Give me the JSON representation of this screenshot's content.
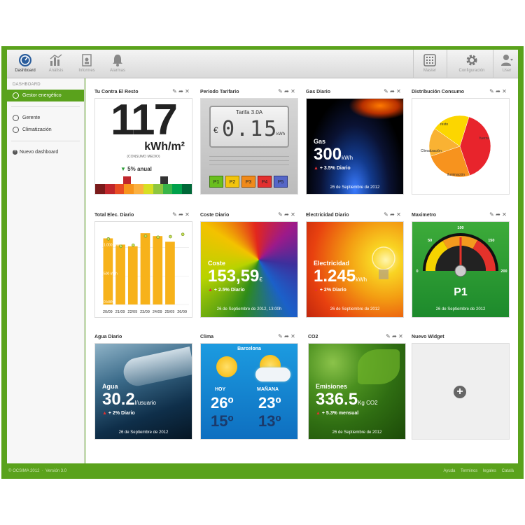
{
  "toolbar": {
    "left": [
      {
        "label": "Dashboard",
        "icon": "dashboard-icon"
      },
      {
        "label": "Análisis",
        "icon": "analysis-icon"
      },
      {
        "label": "Informes",
        "icon": "reports-icon"
      },
      {
        "label": "Alarmas",
        "icon": "bell-icon"
      }
    ],
    "right": [
      {
        "label": "Master",
        "icon": "grid-icon"
      },
      {
        "label": "Configuración",
        "icon": "gear-icon"
      },
      {
        "label": "User",
        "icon": "user-icon"
      }
    ]
  },
  "sidebar": {
    "section": "DASHBOARD",
    "items": [
      {
        "label": "Gestor energético",
        "active": true
      },
      {
        "label": "Gerente"
      },
      {
        "label": "Climatización"
      }
    ],
    "new_dashboard": "Nuevo dashboard"
  },
  "widgets": {
    "contra": {
      "title": "Tu Contra El Resto",
      "value": "117",
      "unit": "kWh/m²",
      "caption": "(CONSUMO MEDIO)",
      "trend": "5% anual"
    },
    "periodo": {
      "title": "Periodo Tarifario",
      "tarifa": "Tarifa 3.0A",
      "reading": "0.15",
      "currency": "€",
      "unit": "kWh",
      "periods": [
        "P1",
        "P2",
        "P3",
        "P4",
        "P5"
      ]
    },
    "gas": {
      "title": "Gas Diario",
      "label": "Gas",
      "value": "300",
      "unit": "kWh",
      "trend": "+ 3.5% Diario",
      "date": "26 de Septiembre de 2012"
    },
    "distribucion": {
      "title": "Distribución Consumo",
      "labels": [
        "resto",
        "fuerza",
        "Climatización",
        "iluminación"
      ]
    },
    "total": {
      "title": "Total Elec. Diario"
    },
    "coste": {
      "title": "Coste Diario",
      "label": "Coste",
      "value": "153,59",
      "unit": "€",
      "trend": "+ 2.5% Diario",
      "date": "26 de Septiembre de 2012, 13:00h"
    },
    "electricidad": {
      "title": "Electricidad Diario",
      "label": "Electricidad",
      "value": "1.245",
      "unit": "kWh",
      "trend": "+ 2% Diario",
      "date": "26 de Septiembre de 2012"
    },
    "maximetro": {
      "title": "Maximetro",
      "period": "P1",
      "date": "26 de Septiembre de 2012",
      "ticks": [
        "0",
        "50",
        "100",
        "150",
        "200"
      ]
    },
    "agua": {
      "title": "Agua Diario",
      "label": "Agua",
      "value": "30.2",
      "unit": "l/usuario",
      "trend": "+ 2% Diario",
      "date": "26 de Septiembre de 2012"
    },
    "clima": {
      "title": "Clima",
      "city": "Barcelona",
      "today": "HOY",
      "tomorrow": "MAÑANA",
      "today_max": "26º",
      "today_min": "15º",
      "tomorrow_max": "23º",
      "tomorrow_min": "13º"
    },
    "co2": {
      "title": "CO2",
      "label": "Emisiones",
      "value": "336.5",
      "unit": "Kg CO2",
      "trend": "+ 5.3% mensual",
      "date": "26 de Septiembre de 2012"
    },
    "nuevo": {
      "title": "Nuevo Widget"
    }
  },
  "chart_data": [
    {
      "type": "bar",
      "categories": [
        "20/09",
        "21/09",
        "22/09",
        "23/09",
        "24/09",
        "25/09",
        "26/09"
      ],
      "values": [
        1160,
        1050,
        1020,
        1250,
        1200,
        1100,
        null
      ],
      "markers": [
        1150,
        1020,
        1040,
        1200,
        1180,
        1190,
        1230
      ],
      "yticks": [
        "0 kWh",
        "500 kWh",
        "1.000 kWh"
      ],
      "ylim": [
        0,
        1350
      ]
    },
    {
      "type": "pie",
      "labels": [
        "fuerza",
        "iluminación",
        "Climatización",
        "resto"
      ],
      "values": [
        40,
        25,
        15,
        20
      ],
      "colors": [
        "#e8242c",
        "#f7931e",
        "#f9b233",
        "#fcd600"
      ]
    }
  ],
  "gauge": {
    "value": 100,
    "min": 0,
    "max": 200
  },
  "footer": {
    "left": "© OCSIMA 2012",
    "version": "Versión 3.0",
    "links": [
      "Ayuda",
      "Terminos legales",
      "Català"
    ]
  }
}
